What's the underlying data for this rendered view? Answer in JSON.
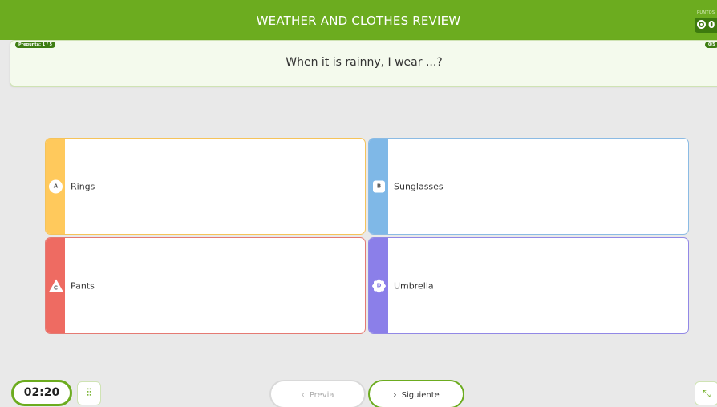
{
  "header": {
    "title": "WEATHER AND CLOTHES REVIEW",
    "points_label": "PUNTOS",
    "points_value": "0"
  },
  "question": {
    "counter": "Pregunta: 1 / 5",
    "progress": "0/5",
    "text": "When it is rainny, I wear ...?"
  },
  "answers": [
    {
      "letter": "A",
      "label": "Rings",
      "color": "#ffc95c",
      "border": "#f5c35a",
      "shape": "circle"
    },
    {
      "letter": "B",
      "label": "Sunglasses",
      "color": "#7fb8e7",
      "border": "#8bbbe4",
      "shape": "square"
    },
    {
      "letter": "C",
      "label": "Pants",
      "color": "#ee6b62",
      "border": "#e57a73",
      "shape": "triangle"
    },
    {
      "letter": "D",
      "label": "Umbrella",
      "color": "#8b7fe9",
      "border": "#9288e6",
      "shape": "star"
    }
  ],
  "footer": {
    "timer": "02:20",
    "tools_icon": "equalizer-icon",
    "prev_label": "Previa",
    "next_label": "Siguiente",
    "shrink_icon": "collapse-icon"
  },
  "colors": {
    "brand_green": "#6cac1f",
    "dark_green": "#3e7d12"
  }
}
